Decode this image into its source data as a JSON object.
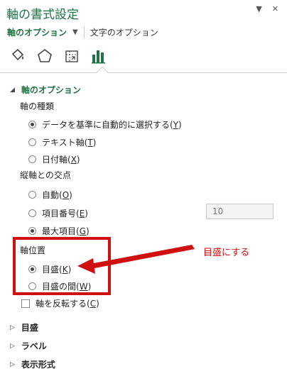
{
  "panel": {
    "title": "軸の書式設定",
    "ctrl_dropdown": "▼",
    "ctrl_close": "✕"
  },
  "tabs": {
    "axis_options": "軸のオプション",
    "text_options": "文字のオプション"
  },
  "icons": [
    "fill-line-icon",
    "effects-pentagon-icon",
    "size-properties-icon",
    "axis-options-bar-chart-icon"
  ],
  "sections": {
    "axis_options": "軸のオプション",
    "tick_marks": "目盛",
    "labels": "ラベル",
    "number": "表示形式"
  },
  "axis_type": {
    "label": "軸の種類",
    "auto": {
      "text": "データを基準に自動的に選択する(",
      "key": "Y",
      "close": ")"
    },
    "text_axis": {
      "text": "テキスト軸(",
      "key": "T",
      "close": ")"
    },
    "date_axis": {
      "text": "日付軸(",
      "key": "X",
      "close": ")"
    }
  },
  "crosses": {
    "label": "縦軸との交点",
    "auto": {
      "text": "自動(",
      "key": "O",
      "close": ")"
    },
    "category_number": {
      "text": "項目番号(",
      "key": "E",
      "close": ")"
    },
    "category_value": "10",
    "max_category": {
      "text": "最大項目(",
      "key": "G",
      "close": ")"
    }
  },
  "axis_position": {
    "label": "軸位置",
    "on_tick": {
      "text": "目盛(",
      "key": "K",
      "close": ")"
    },
    "between": {
      "text": "目盛の間(",
      "key": "W",
      "close": ")"
    }
  },
  "reverse": {
    "text": "軸を反転する(",
    "key": "C",
    "close": ")"
  },
  "callout": "目盛にする",
  "colors": {
    "accent": "#217346",
    "annotation": "#d01010"
  }
}
